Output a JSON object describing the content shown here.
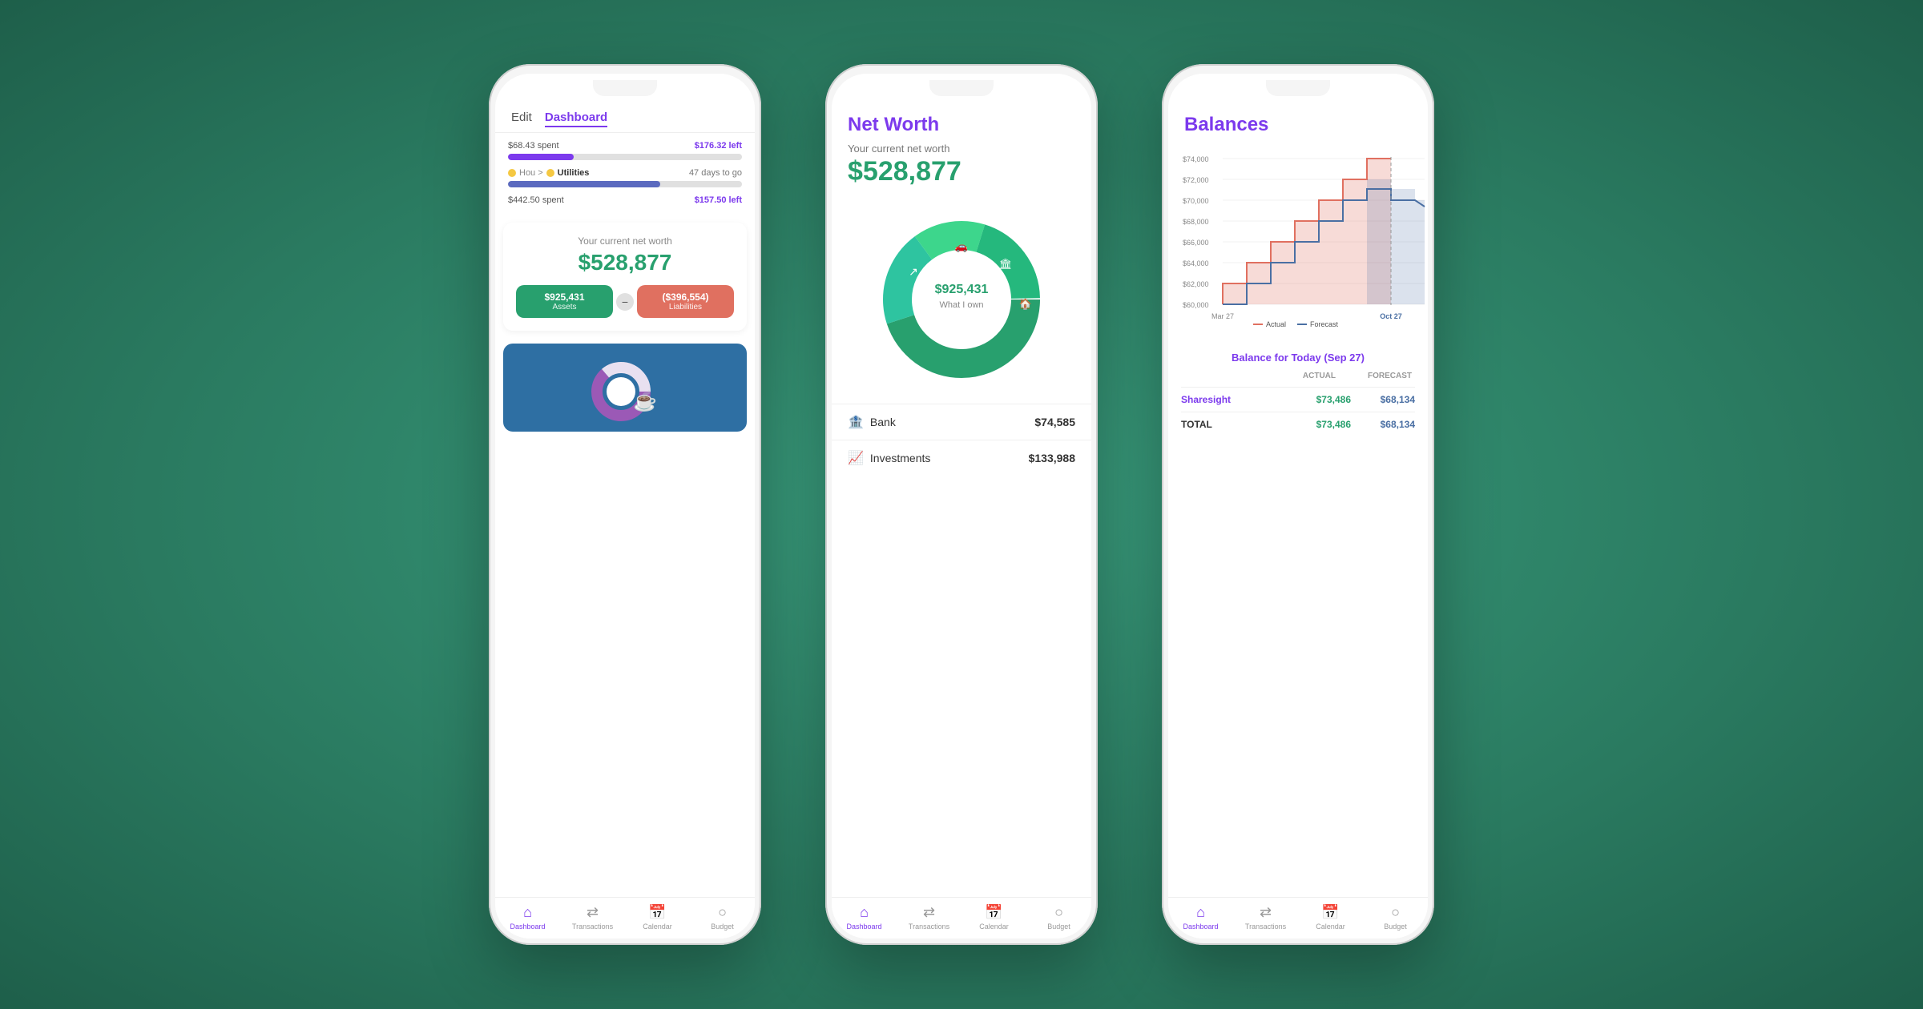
{
  "background_color": "#2e8b6e",
  "phones": [
    {
      "id": "phone1",
      "header": {
        "edit_label": "Edit",
        "dashboard_label": "Dashboard"
      },
      "budget_rows": [
        {
          "spent": "$68.43 spent",
          "left": "$176.32 left",
          "progress": 28,
          "color": "#7c3aed"
        },
        {
          "category": "Hou > Utilities",
          "dot_color": "yellow",
          "days": "47 days to go",
          "spent": "$442.50 spent",
          "left": "$157.50 left",
          "progress": 74,
          "color": "#5b6abf"
        }
      ],
      "net_worth": {
        "label": "Your current net worth",
        "value": "$528,877",
        "assets": "$925,431",
        "assets_label": "Assets",
        "liabilities": "($396,554)",
        "liabilities_label": "Liabilities"
      },
      "nav": {
        "items": [
          {
            "icon": "🏠",
            "label": "Dashboard",
            "active": true
          },
          {
            "icon": "💳",
            "label": "Transactions",
            "active": false
          },
          {
            "icon": "📅",
            "label": "Calendar",
            "active": false
          },
          {
            "icon": "💰",
            "label": "Budget",
            "active": false
          }
        ]
      }
    },
    {
      "id": "phone2",
      "title": "Net Worth",
      "subtitle": "Your current net worth",
      "value": "$528,877",
      "donut": {
        "center_value": "$925,431",
        "center_label": "What I own",
        "segments": [
          {
            "label": "investments",
            "color": "#28a06e",
            "percent": 45
          },
          {
            "label": "car",
            "color": "#2ec4a0",
            "percent": 20
          },
          {
            "label": "bank",
            "color": "#3dd68c",
            "percent": 15
          },
          {
            "label": "home",
            "color": "#25b87d",
            "percent": 20
          }
        ]
      },
      "list_items": [
        {
          "icon": "🏦",
          "name": "Bank",
          "value": "$74,585"
        },
        {
          "icon": "📈",
          "name": "Investments",
          "value": "$133,988"
        }
      ],
      "nav": {
        "items": [
          {
            "icon": "🏠",
            "label": "Dashboard",
            "active": true
          },
          {
            "icon": "💳",
            "label": "Transactions",
            "active": false
          },
          {
            "icon": "📅",
            "label": "Calendar",
            "active": false
          },
          {
            "icon": "💰",
            "label": "Budget",
            "active": false
          }
        ]
      }
    },
    {
      "id": "phone3",
      "title": "Balances",
      "chart": {
        "x_start": "Mar 27",
        "x_end": "Oct 27",
        "legend": [
          {
            "label": "Actual",
            "color": "#e07060"
          },
          {
            "label": "Forecast",
            "color": "#4a6fa3"
          }
        ],
        "y_labels": [
          "$74,000",
          "$72,000",
          "$70,000",
          "$68,000",
          "$66,000",
          "$64,000",
          "$62,000",
          "$60,000"
        ]
      },
      "balance_table": {
        "title": "Balance for Today (Sep 27)",
        "headers": [
          "ACTUAL",
          "FORECAST"
        ],
        "rows": [
          {
            "name": "Sharesight",
            "actual": "$73,486",
            "forecast": "$68,134"
          },
          {
            "name": "TOTAL",
            "actual": "$73,486",
            "forecast": "$68,134",
            "is_total": true
          }
        ]
      },
      "nav": {
        "items": [
          {
            "icon": "🏠",
            "label": "Dashboard",
            "active": true
          },
          {
            "icon": "💳",
            "label": "Transactions",
            "active": false
          },
          {
            "icon": "📅",
            "label": "Calendar",
            "active": false
          },
          {
            "icon": "💰",
            "label": "Budget",
            "active": false
          }
        ]
      }
    }
  ]
}
